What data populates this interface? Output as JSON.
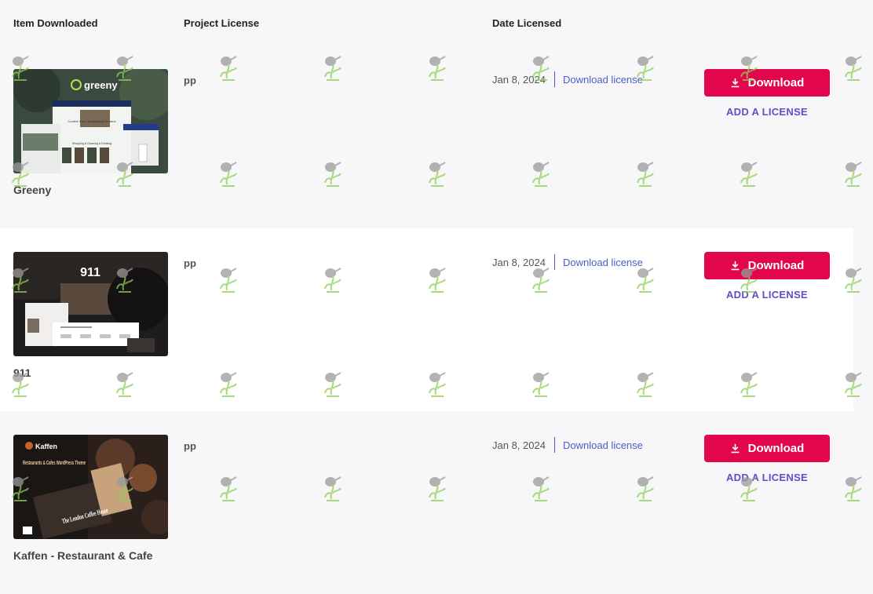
{
  "columns": {
    "item": "Item Downloaded",
    "project": "Project License",
    "date": "Date Licensed"
  },
  "items": [
    {
      "name": "Greeny",
      "project": "pp",
      "date": "Jan 8, 2024",
      "license_link": "Download license",
      "download_label": "Download",
      "add_license_label": "ADD A LICENSE",
      "thumb": {
        "logo": "greeny",
        "headline": "Control Your Landscaping Dreams",
        "subhead": "Shopping & Cleaning & Drinking"
      }
    },
    {
      "name": "911",
      "project": "pp",
      "date": "Jan 8, 2024",
      "license_link": "Download license",
      "download_label": "Download",
      "add_license_label": "ADD A LICENSE",
      "thumb": {
        "logo": "911"
      }
    },
    {
      "name": "Kaffen - Restaurant & Cafe",
      "project": "pp",
      "date": "Jan 8, 2024",
      "license_link": "Download license",
      "download_label": "Download",
      "add_license_label": "ADD A LICENSE",
      "thumb": {
        "logo": "Kaffen",
        "headline": "Restaurants & Cafes WordPress Theme",
        "sign": "The London Coffee House"
      }
    }
  ],
  "colors": {
    "accent": "#e2064d",
    "link": "#4a5fc7",
    "add_license": "#5b4fc9",
    "row_alt": "#ffffff",
    "background": "#f7f7fa"
  },
  "icons": {
    "download": "download-icon",
    "watermark": "watering-can-watermark-icon"
  }
}
